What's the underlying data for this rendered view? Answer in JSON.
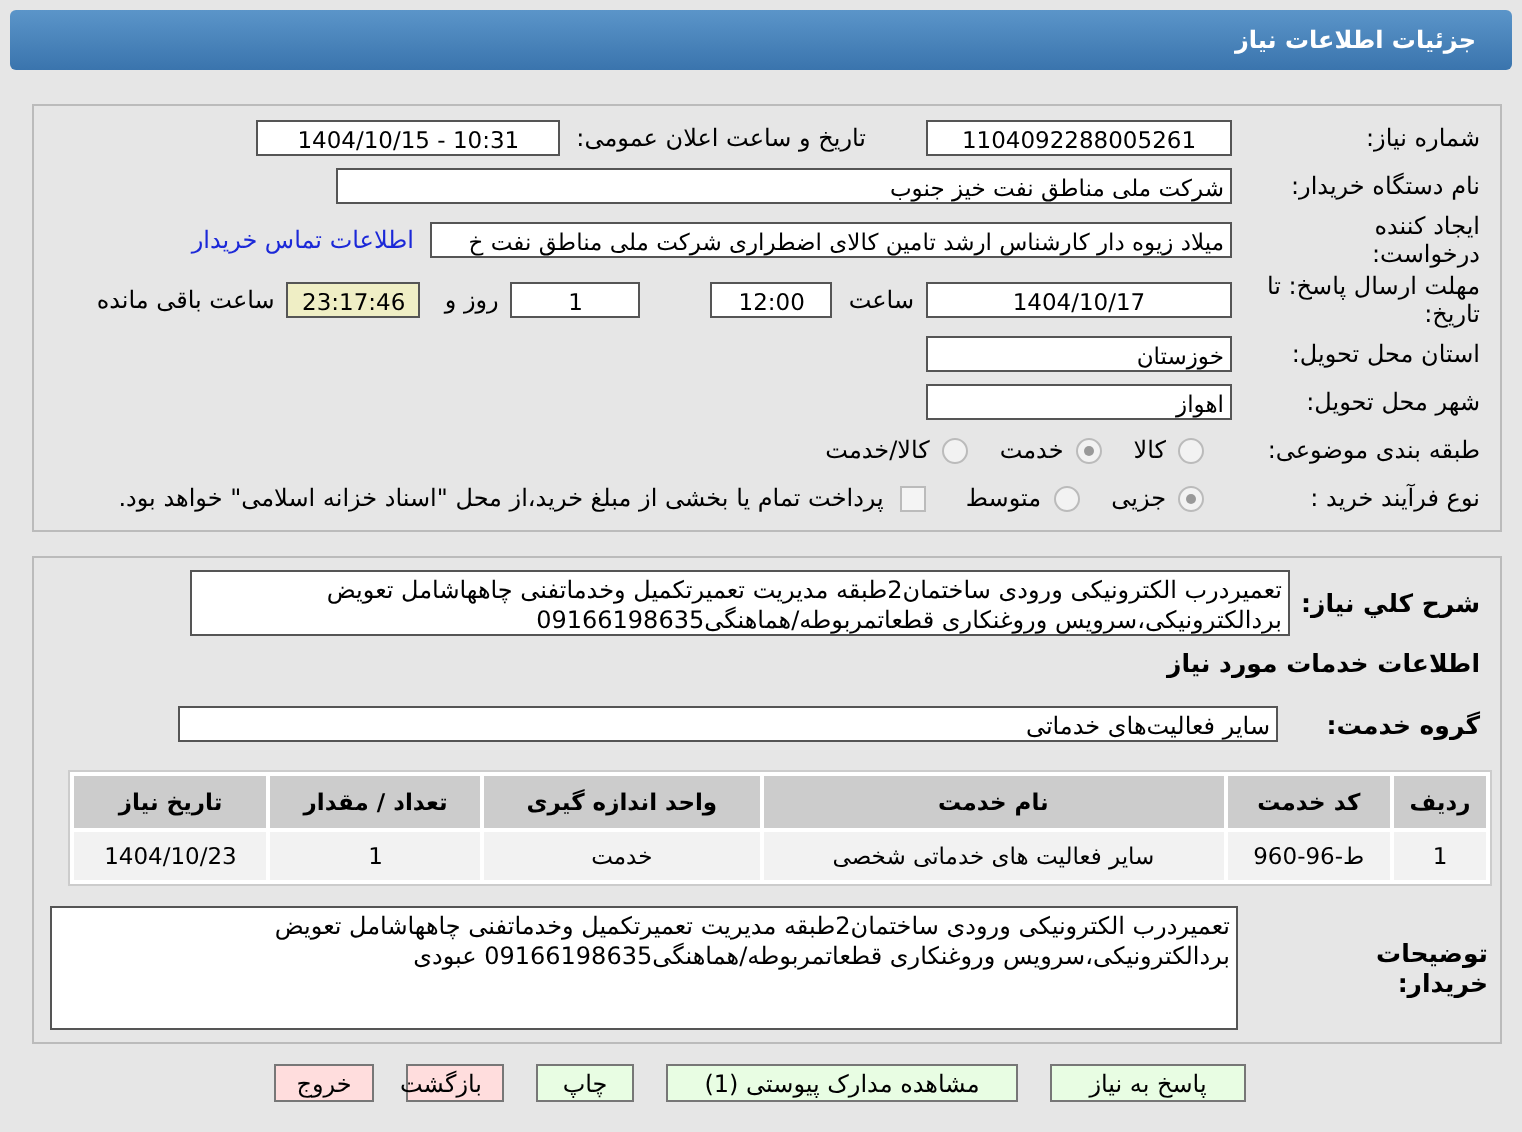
{
  "header": {
    "title": "جزئیات اطلاعات نیاز"
  },
  "details": {
    "need_number": {
      "label": "شماره نیاز:",
      "value": "1104092288005261"
    },
    "announce": {
      "label": "تاریخ و ساعت اعلان عمومی:",
      "value": "1404/10/15 - 10:31"
    },
    "buyer_org": {
      "label": "نام دستگاه خریدار:",
      "value": "شرکت ملی مناطق نفت خیز جنوب"
    },
    "creator": {
      "label": "ایجاد کننده درخواست:",
      "value": "میلاد زیوه دار  کارشناس ارشد تامین کالای اضطراری شرکت ملی مناطق نفت خ",
      "link": "اطلاعات تماس خریدار"
    },
    "deadline": {
      "label": "مهلت ارسال پاسخ: تا تاریخ:",
      "date": "1404/10/17",
      "time_label": "ساعت",
      "time": "12:00",
      "days": "1",
      "days_label": "روز و",
      "remaining": "23:17:46",
      "remaining_label": "ساعت باقی مانده"
    },
    "province": {
      "label": "استان محل تحویل:",
      "value": "خوزستان"
    },
    "city": {
      "label": "شهر محل تحویل:",
      "value": "اهواز"
    },
    "category": {
      "label": "طبقه بندی موضوعی:",
      "options": [
        {
          "label": "کالا",
          "selected": false
        },
        {
          "label": "خدمت",
          "selected": true
        },
        {
          "label": "کالا/خدمت",
          "selected": false
        }
      ]
    },
    "process": {
      "label": "نوع فرآیند خرید :",
      "options": [
        {
          "label": "جزیی",
          "selected": true
        },
        {
          "label": "متوسط",
          "selected": false
        }
      ],
      "payment": {
        "checked": false,
        "text": "پرداخت تمام یا بخشی از مبلغ خرید،از محل \"اسناد خزانه اسلامی\" خواهد بود."
      }
    }
  },
  "need": {
    "description": {
      "label": "شرح کلي نياز:",
      "value": "تعمیردرب الکترونیکی ورودی ساختمان2طبقه مدیریت تعمیرتکمیل وخدماتفنی چاهها‌شامل تعویض بردالکترونیکی،سرویس وروغنکاری قطعاتمربوطه/هماهنگی09166198635"
    },
    "section_title": "اطلاعات خدمات مورد نياز",
    "service_group": {
      "label": "گروه خدمت:",
      "value": "سایر فعالیت‌های خدماتی"
    },
    "table": {
      "columns": [
        "ردیف",
        "کد خدمت",
        "نام خدمت",
        "واحد اندازه گیری",
        "تعداد / مقدار",
        "تاریخ نیاز"
      ],
      "rows": [
        [
          "1",
          "ط-96-960",
          "سایر فعالیت های خدماتی شخصی",
          "خدمت",
          "1",
          "1404/10/23"
        ]
      ]
    },
    "buyer_notes": {
      "label": "توضیحات خریدار:",
      "value": "تعمیردرب الکترونیکی ورودی ساختمان2طبقه مدیریت تعمیرتکمیل وخدماتفنی چاهها‌شامل تعویض بردالکترونیکی،سرویس وروغنکاری قطعاتمربوطه/هماهنگی09166198635 عبودی"
    }
  },
  "buttons": [
    {
      "label": "پاسخ به نیاز",
      "kind": "normal"
    },
    {
      "label": "مشاهده مدارک پیوستی (1)",
      "kind": "normal"
    },
    {
      "label": "چاپ",
      "kind": "normal"
    },
    {
      "label": "بازگشت",
      "kind": "exit"
    },
    {
      "label": "خروج",
      "kind": "exit"
    }
  ]
}
